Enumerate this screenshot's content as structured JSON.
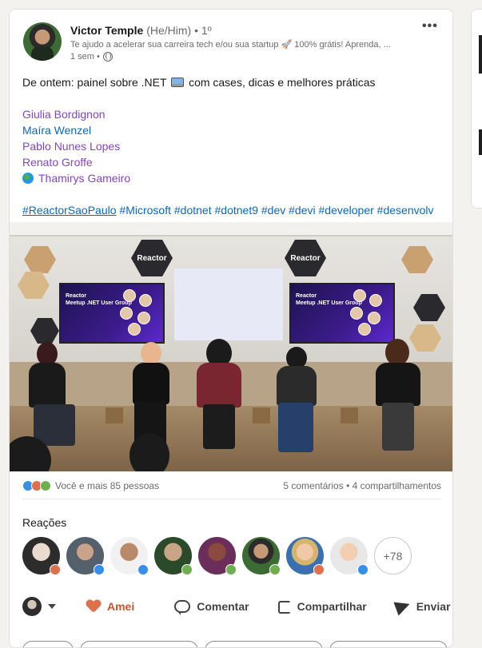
{
  "post": {
    "author": {
      "name": "Victor Temple",
      "pronouns": "(He/Him)",
      "degree": "• 1º",
      "headline": "Te ajudo a acelerar sua carreira tech e/ou sua startup 🚀 100% grátis! Aprenda, ...",
      "time": "1 sem •",
      "visibility_icon": "globe-icon"
    },
    "menu_label": "•••",
    "text": {
      "intro_before": "De ontem: painel sobre .NET",
      "intro_after": "com cases, dicas e melhores práticas",
      "mentions": [
        "Giulia Bordignon",
        "Maíra Wenzel",
        "Pablo Nunes Lopes",
        "Renato Groffe",
        "Thamirys Gameiro"
      ],
      "hashtags": [
        "#ReactorSaoPaulo",
        "#Microsoft",
        "#dotnet",
        "#dotnet9",
        "#dev",
        "#devi",
        "#developer",
        "#desenvolv"
      ]
    },
    "image": {
      "screen_title": "Reactor\nMeetup .NET User Group",
      "reactor_label": "Reactor"
    },
    "social": {
      "reactions_text": "Você e mais 85 pessoas",
      "comments": "5 comentários",
      "separator": "•",
      "shares": "4 compartilhamentos"
    },
    "reactions_section": {
      "title": "Reações",
      "more_count": "+78"
    },
    "actions": {
      "love": "Amei",
      "comment": "Comentar",
      "share": "Compartilhar",
      "send": "Enviar"
    }
  },
  "colors": {
    "link_purple": "#8344cc",
    "link_blue": "#0a66c2",
    "love": "#df704d",
    "like": "#378fe9",
    "support": "#6dae4f"
  }
}
